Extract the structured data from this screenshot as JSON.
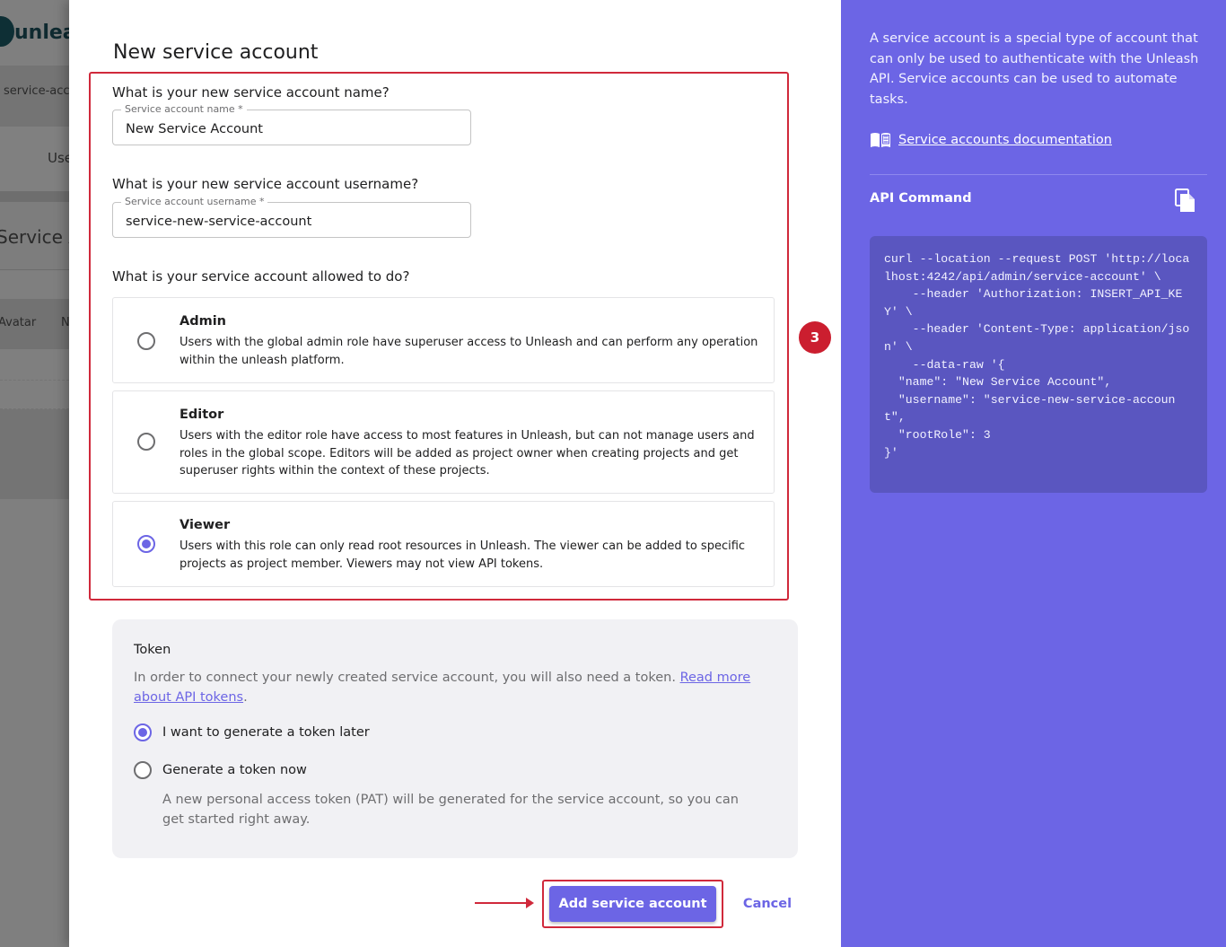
{
  "background": {
    "logo_text": "unleash",
    "breadcrumb": "service-accounts",
    "tab_users": "Users",
    "page_title": "Service Accounts",
    "col_avatar": "Avatar",
    "col_name": "Name"
  },
  "modal": {
    "title": "New service account",
    "name_question": "What is your new service account name?",
    "name_field": {
      "label": "Service account name *",
      "value": "New Service Account"
    },
    "username_question": "What is your new service account username?",
    "username_field": {
      "label": "Service account username *",
      "value": "service-new-service-account"
    },
    "role_question": "What is your service account allowed to do?",
    "roles": [
      {
        "name": "Admin",
        "description": "Users with the global admin role have superuser access to Unleash and can perform any operation within the unleash platform.",
        "selected": false
      },
      {
        "name": "Editor",
        "description": "Users with the editor role have access to most features in Unleash, but can not manage users and roles in the global scope. Editors will be added as project owner when creating projects and get superuser rights within the context of these projects.",
        "selected": false
      },
      {
        "name": "Viewer",
        "description": "Users with this role can only read root resources in Unleash. The viewer can be added to specific projects as project member. Viewers may not view API tokens.",
        "selected": true
      }
    ],
    "step_badge": "3",
    "token": {
      "title": "Token",
      "description": "In order to connect your newly created service account, you will also need a token. ",
      "link_text": "Read more about API tokens",
      "description_end": ".",
      "options": [
        {
          "label": "I want to generate a token later",
          "selected": true
        },
        {
          "label": "Generate a token now",
          "selected": false
        }
      ],
      "hint": "A new personal access token (PAT) will be generated for the service account, so you can get started right away."
    },
    "submit_label": "Add service account",
    "cancel_label": "Cancel"
  },
  "sidebar": {
    "description": "A service account is a special type of account that can only be used to authenticate with the Unleash API. Service accounts can be used to automate tasks.",
    "doc_link": "Service accounts documentation",
    "api_title": "API Command",
    "code": "curl --location --request POST 'http://localhost:4242/api/admin/service-account' \\\n    --header 'Authorization: INSERT_API_KEY' \\\n    --header 'Content-Type: application/json' \\\n    --data-raw '{\n  \"name\": \"New Service Account\",\n  \"username\": \"service-new-service-account\",\n  \"rootRole\": 3\n}'"
  },
  "colors": {
    "primary": "#6c65e5",
    "annotation_red": "#d0293b",
    "code_bg": "#5a56c0"
  }
}
